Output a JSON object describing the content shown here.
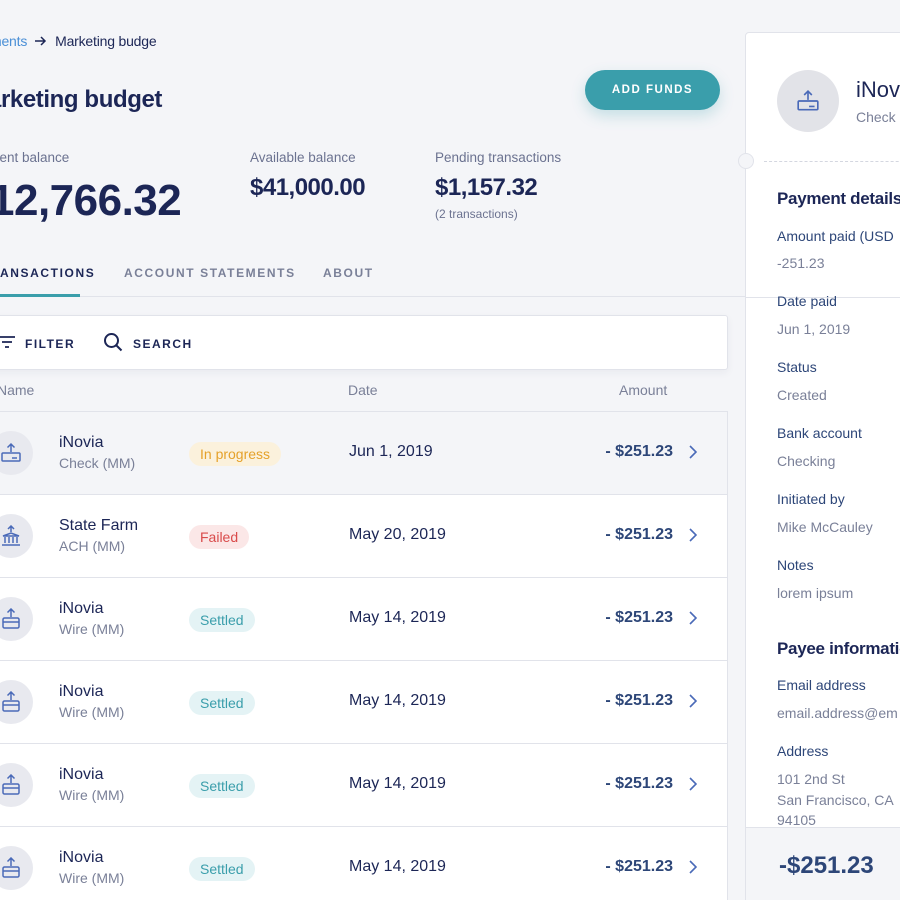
{
  "breadcrumb": {
    "previous": "ments",
    "current": "Marketing budge"
  },
  "page": {
    "title": "arketing budget",
    "add_funds_label": "ADD FUNDS"
  },
  "stats": {
    "current": {
      "label": "rent balance",
      "value": "12,766.32"
    },
    "available": {
      "label": "Available balance",
      "value": "$41,000.00"
    },
    "pending": {
      "label": "Pending transactions",
      "value": "$1,157.32",
      "sub": "(2 transactions)"
    }
  },
  "tabs": [
    "ANSACTIONS",
    "ACCOUNT STATEMENTS",
    "ABOUT"
  ],
  "toolbar": {
    "filter_label": "FILTER",
    "search_label": "SEARCH"
  },
  "columns": {
    "name": "Name",
    "date": "Date",
    "amount": "Amount"
  },
  "rows": [
    {
      "name": "iNovia",
      "method": "Check (MM)",
      "status": "In progress",
      "date": "Jun 1, 2019",
      "amount": "- $251.23",
      "icon": "check-icon"
    },
    {
      "name": "State Farm",
      "method": "ACH (MM)",
      "status": "Failed",
      "date": "May 20, 2019",
      "amount": "- $251.23",
      "icon": "bank-icon"
    },
    {
      "name": "iNovia",
      "method": "Wire (MM)",
      "status": "Settled",
      "date": "May 14, 2019",
      "amount": "- $251.23",
      "icon": "wire-icon"
    },
    {
      "name": "iNovia",
      "method": "Wire (MM)",
      "status": "Settled",
      "date": "May 14, 2019",
      "amount": "- $251.23",
      "icon": "wire-icon"
    },
    {
      "name": "iNovia",
      "method": "Wire (MM)",
      "status": "Settled",
      "date": "May 14, 2019",
      "amount": "- $251.23",
      "icon": "wire-icon"
    },
    {
      "name": "iNovia",
      "method": "Wire (MM)",
      "status": "Settled",
      "date": "May 14, 2019",
      "amount": "- $251.23",
      "icon": "wire-icon"
    }
  ],
  "detail": {
    "name": "iNovi",
    "sub": "Check",
    "payment_heading": "Payment details",
    "fields": {
      "amount_label": "Amount paid (USD",
      "amount_value": "-251.23",
      "date_label": "Date paid",
      "date_value": "Jun 1, 2019",
      "status_label": "Status",
      "status_value": "Created",
      "bank_label": "Bank account",
      "bank_value": "Checking",
      "initiated_label": "Initiated by",
      "initiated_value": "Mike McCauley",
      "notes_label": "Notes",
      "notes_value": "lorem ipsum"
    },
    "payee_heading": "Payee informatio",
    "payee": {
      "email_label": "Email address",
      "email_value": "email.address@em",
      "address_label": "Address",
      "address_line1": "101 2nd St",
      "address_line2": "San Francisco, CA",
      "address_line3": "94105"
    },
    "footer_amount": "-$251.23"
  },
  "colors": {
    "accent": "#3a9eab",
    "in_progress": "#e5a12a",
    "failed": "#d94b4b",
    "settled": "#3a9eab",
    "text": "#1c2656"
  }
}
